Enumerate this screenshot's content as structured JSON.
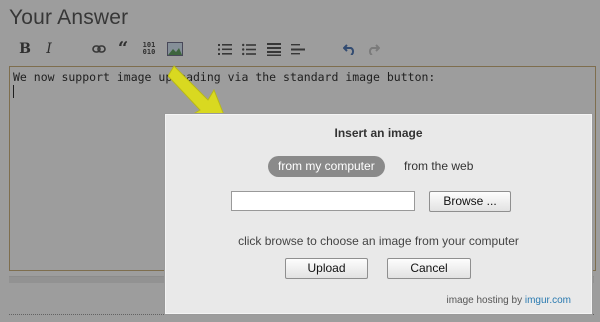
{
  "editor": {
    "title": "Your Answer",
    "text": "We now support image uploading via the standard image button:",
    "toolbar": {
      "bold": "B",
      "italic": "I",
      "link": "🔗",
      "quote": "❝",
      "code": "101\n010",
      "image": "🖼",
      "olist": "≡",
      "ulist": "≡",
      "heading": "≡",
      "hr": "≡",
      "undo": "↶",
      "redo": "↷"
    }
  },
  "dialog": {
    "title": "Insert an image",
    "tab_active": "from my computer",
    "tab_other": "from the web",
    "browse_label": "Browse ...",
    "hint": "click browse to choose an image from your computer",
    "upload_label": "Upload",
    "cancel_label": "Cancel",
    "footer_prefix": "image hosting by ",
    "footer_brand": "imgur.com"
  },
  "colors": {
    "arrow": "#d9d920",
    "overlay": "#7d7d7d",
    "dialog_bg": "#e9e9e9",
    "tab_active_bg": "#8a8a8a",
    "brand_link": "#2a7ab0"
  }
}
